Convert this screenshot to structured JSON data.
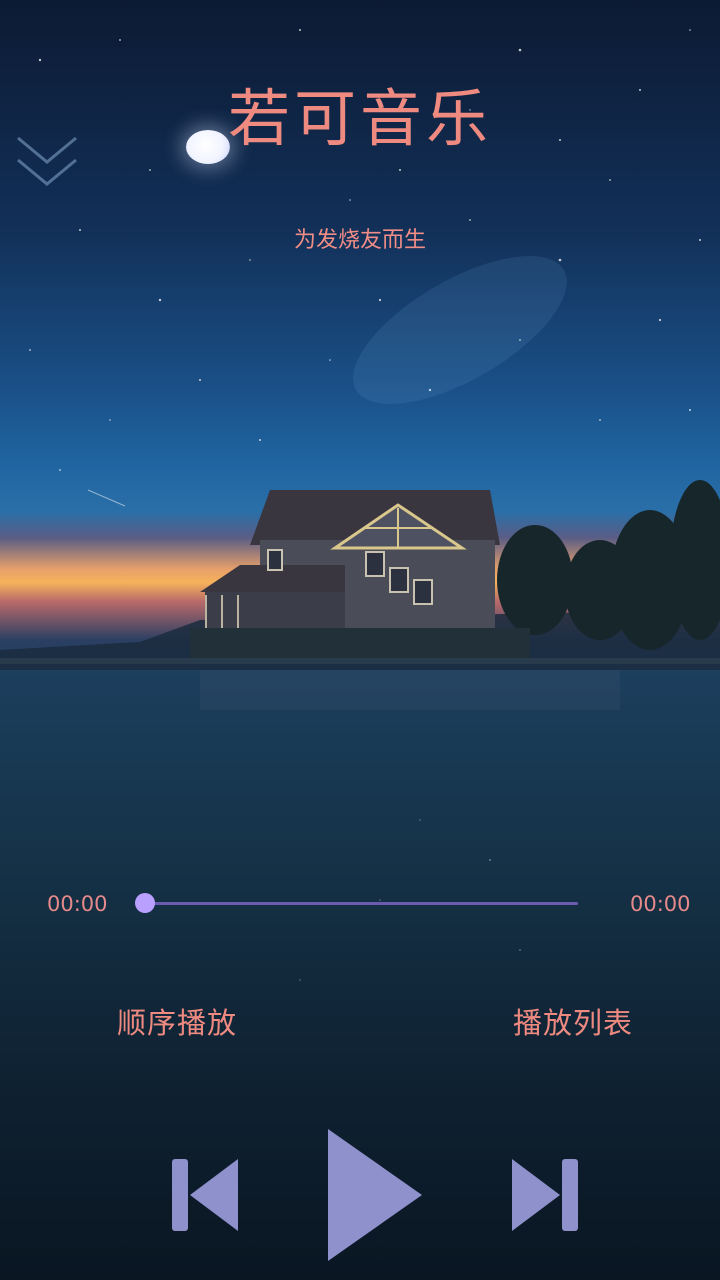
{
  "app": {
    "title": "若可音乐",
    "subtitle": "为发烧友而生"
  },
  "player": {
    "current_time": "00:00",
    "duration": "00:00",
    "progress": 0
  },
  "actions": {
    "play_mode_label": "顺序播放",
    "playlist_label": "播放列表"
  },
  "icons": {
    "collapse": "double-chevron-down-icon",
    "prev": "skip-previous-icon",
    "play": "play-icon",
    "next": "skip-next-icon"
  },
  "colors": {
    "text_accent": "#ef8a80",
    "control": "#8e91cc",
    "slider_track": "#6b5bb0",
    "slider_thumb": "#b9a0ff"
  }
}
